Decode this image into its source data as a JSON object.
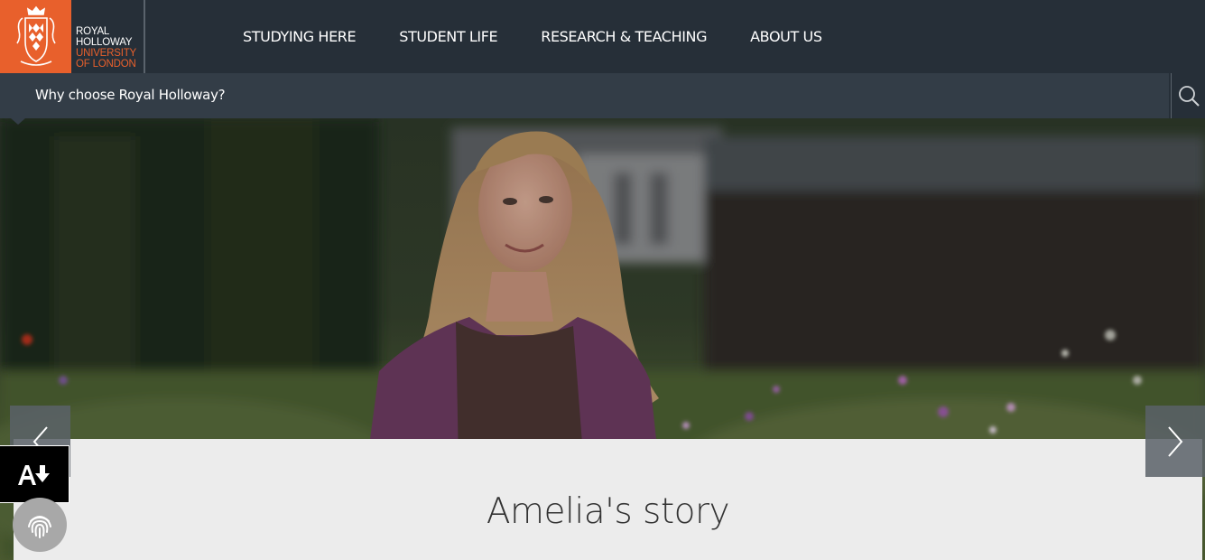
{
  "brand": {
    "line1": "ROYAL",
    "line2": "HOLLOWAY",
    "line3": "UNIVERSITY",
    "line4": "OF LONDON",
    "logo_icon": "crest-icon",
    "brand_color": "#e8602c"
  },
  "nav": {
    "items": [
      {
        "label": "STUDYING HERE"
      },
      {
        "label": "STUDENT LIFE"
      },
      {
        "label": "RESEARCH & TEACHING"
      },
      {
        "label": "ABOUT US"
      }
    ]
  },
  "subnav": {
    "title": "Why choose Royal Holloway?",
    "search_icon": "search-icon"
  },
  "hero": {
    "image": "student-portrait-in-garden",
    "prev_icon": "chevron-left-icon",
    "next_icon": "chevron-right-icon"
  },
  "story": {
    "title": "Amelia's story"
  },
  "widgets": {
    "accessibility_icon": "text-download-icon",
    "fingerprint_icon": "fingerprint-icon"
  }
}
